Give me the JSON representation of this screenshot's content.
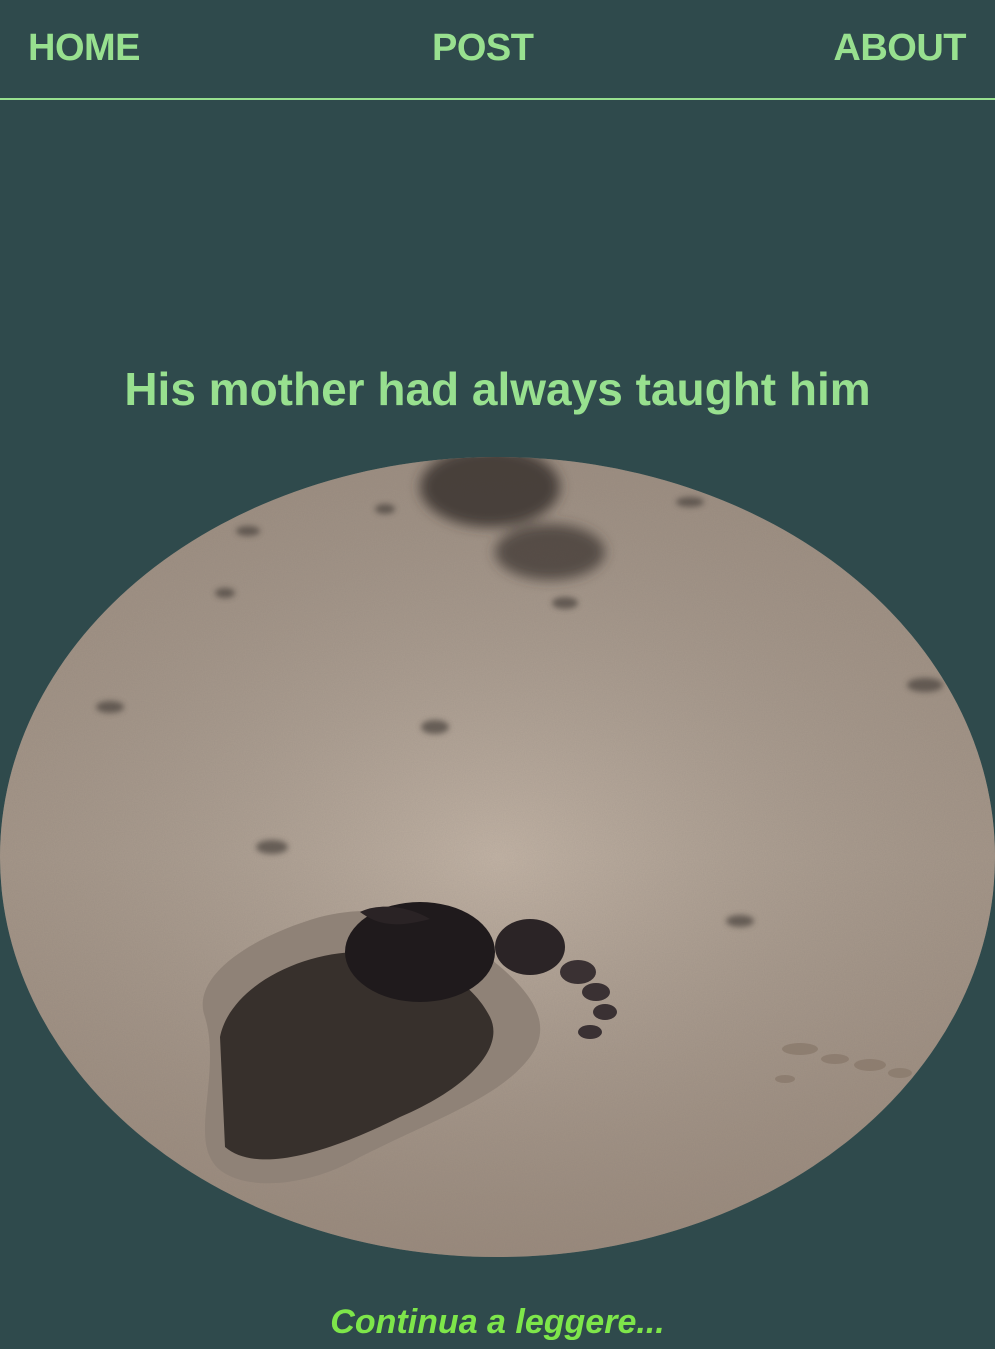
{
  "nav": {
    "home": "HOME",
    "post": "POST",
    "about": "ABOUT"
  },
  "post": {
    "title": "His mother had always taught him",
    "read_more": "Continua a leggere..."
  },
  "colors": {
    "background": "#2f4a4c",
    "accent": "#98e08f",
    "link": "#7ee64a"
  }
}
